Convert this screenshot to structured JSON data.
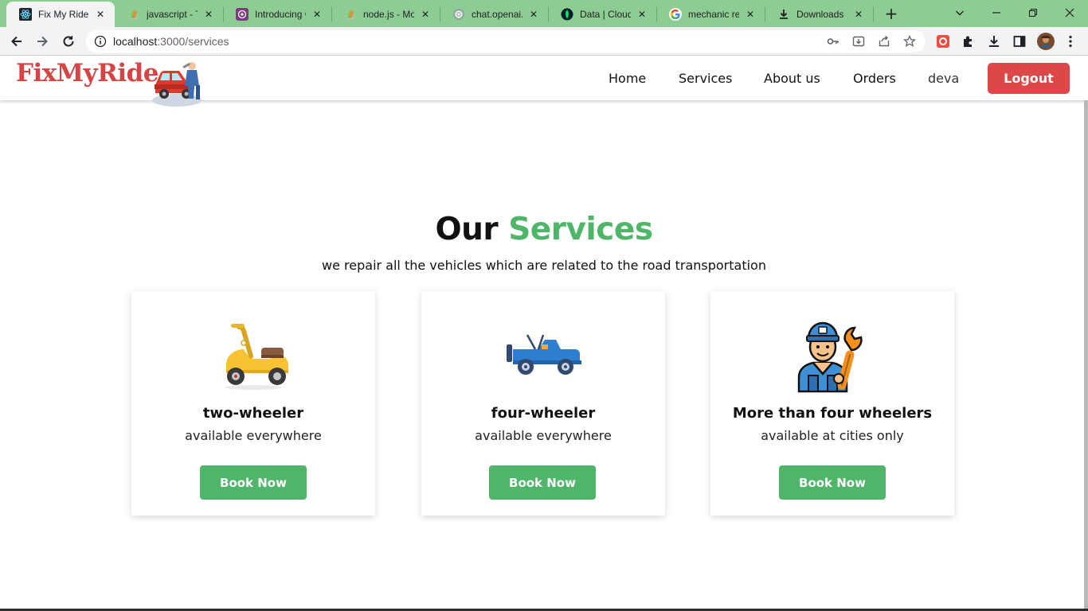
{
  "browser": {
    "tabs": [
      {
        "title": "Fix My Ride",
        "icon": "react-icon",
        "active": true
      },
      {
        "title": "javascript - Ty",
        "icon": "stackoverflow-icon",
        "active": false
      },
      {
        "title": "Introducing C",
        "icon": "openai-icon",
        "active": false
      },
      {
        "title": "node.js - Mor",
        "icon": "stackoverflow-icon",
        "active": false
      },
      {
        "title": "chat.openai.co",
        "icon": "openai-icon",
        "active": false
      },
      {
        "title": "Data | Cloud",
        "icon": "mongodb-icon",
        "active": false
      },
      {
        "title": "mechanic real",
        "icon": "google-icon",
        "active": false
      },
      {
        "title": "Downloads",
        "icon": "download-icon",
        "active": false
      }
    ],
    "new_tab": "+",
    "url_host": "localhost",
    "url_rest": ":3000/services"
  },
  "site": {
    "brand": "FixMyRide",
    "nav": {
      "home": "Home",
      "services": "Services",
      "about": "About us",
      "orders": "Orders",
      "user": "deva",
      "logout": "Logout"
    },
    "section": {
      "title_part1": "Our",
      "title_part2": "Services",
      "subtitle": "we repair all the vehicles which are related to the road transportation"
    },
    "cards": [
      {
        "title": "two-wheeler",
        "subtitle": "available everywhere",
        "button": "Book Now",
        "icon": "scooter-icon"
      },
      {
        "title": "four-wheeler",
        "subtitle": "available everywhere",
        "button": "Book Now",
        "icon": "jeep-icon"
      },
      {
        "title": "More than four wheelers",
        "subtitle": "available at cities only",
        "button": "Book Now",
        "icon": "mechanic-icon"
      }
    ]
  },
  "colors": {
    "accent_green": "#4fb569",
    "brand_red": "#d64545",
    "logout_red": "#dc4848",
    "chrome_frame": "#8dcc93"
  }
}
